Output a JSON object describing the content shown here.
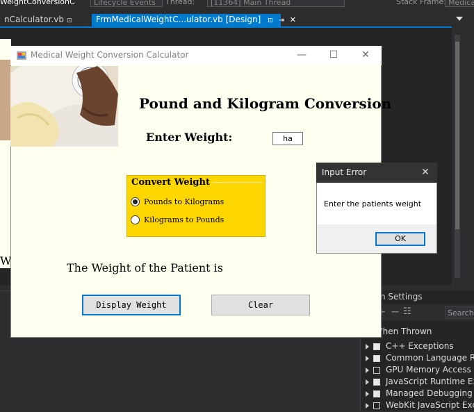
{
  "ide": {
    "topbar_left": "WeightConversionC",
    "lifecycle": "Lifecycle Events",
    "thread_label": "Thread:",
    "thread_value": "[11364] Main Thread",
    "stack_label": "Stack Frame:",
    "stack_value": "Medica",
    "tab1": "nCalculator.vb",
    "tab1_pin": "⊡",
    "tab2": "FrmMedicalWeightC...ulator.vb [Design]",
    "tab2_pin": "⊡",
    "tab2_pin2": "⇥",
    "tab2_close": "✕",
    "behind_w": "W",
    "exception_settings": {
      "title": "ption Settings",
      "search": "Search",
      "column": "k When Thrown",
      "rows": [
        {
          "label": "C++ Exceptions",
          "checked": true
        },
        {
          "label": "Common Language Ru",
          "checked": true
        },
        {
          "label": "GPU Memory Access E",
          "checked": false
        },
        {
          "label": "JavaScript Runtime Exc",
          "checked": true
        },
        {
          "label": "Managed Debugging A",
          "checked": true
        },
        {
          "label": "WebKit JavaScript Exce",
          "checked": false
        }
      ]
    }
  },
  "form": {
    "title": "Medical Weight Conversion Calculator",
    "heading": "Pound and Kilogram Conversion",
    "enter_label": "Enter Weight:",
    "weight_value": "ha",
    "group_title": "Convert Weight",
    "radio1_label": "Pounds to Kilograms",
    "radio1_checked": true,
    "radio2_label": "Kilograms to Pounds",
    "radio2_checked": false,
    "result_label": "The Weight of the Patient is",
    "display_button": "Display Weight",
    "clear_button": "Clear"
  },
  "dialog": {
    "title": "Input Error",
    "message": "Enter the patients weight",
    "ok": "OK"
  },
  "colors": {
    "form_bg": "#fffff0",
    "group_bg": "#ffd700",
    "accent": "#007acc"
  }
}
